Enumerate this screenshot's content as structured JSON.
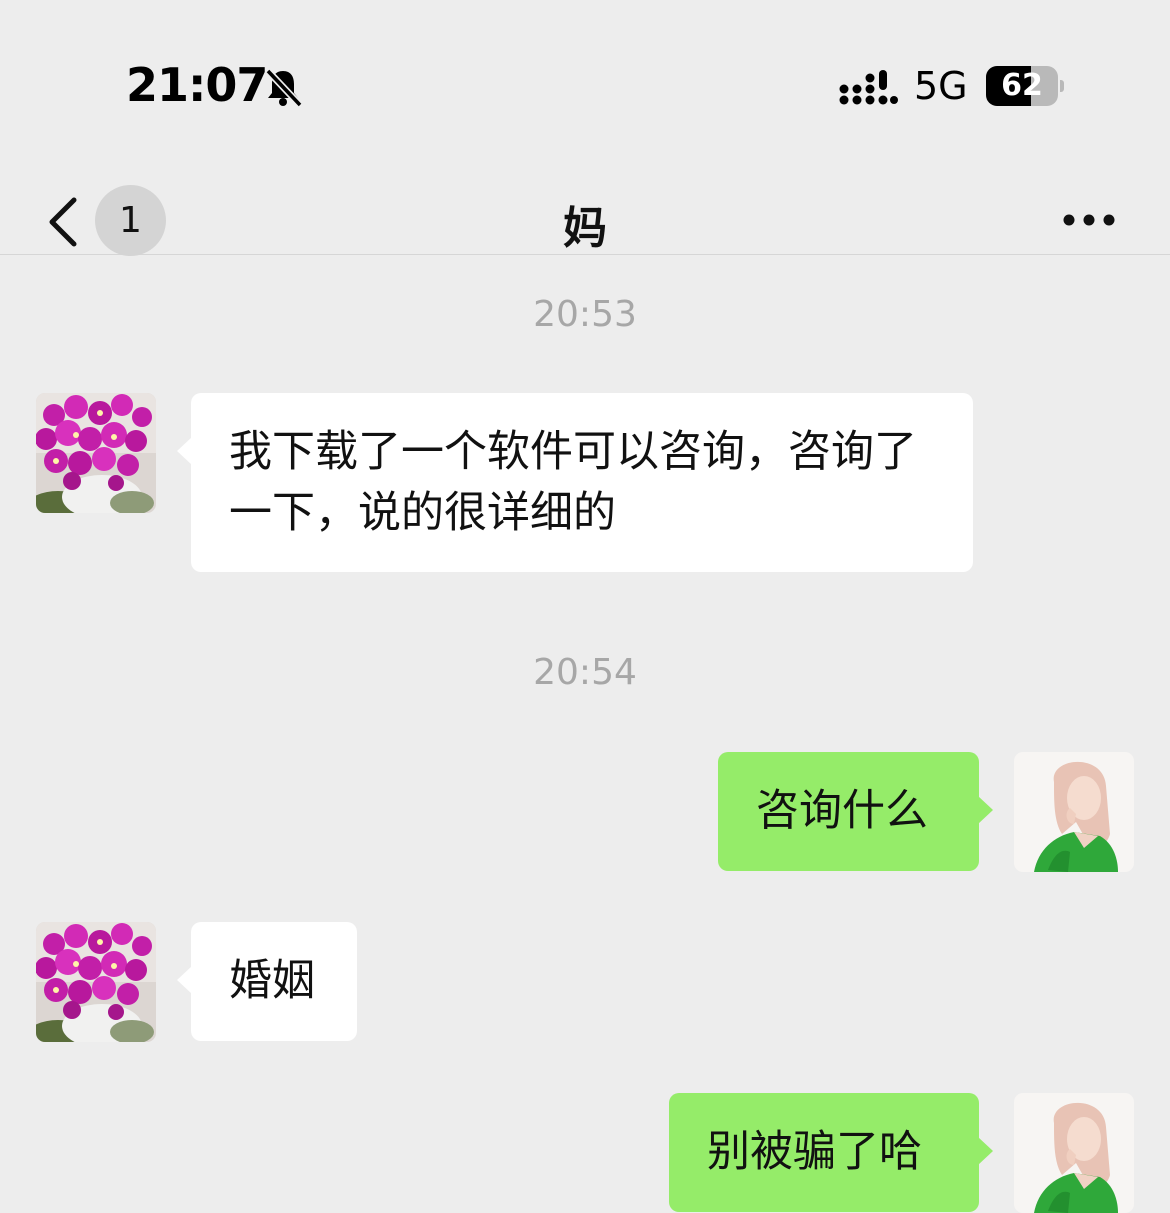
{
  "status_bar": {
    "time": "21:07",
    "mute_icon": "bell-slash-icon",
    "signal_icon": "cellular-signal-icon",
    "network": "5G",
    "battery_level": "62",
    "battery_fraction": 0.62
  },
  "nav": {
    "back_icon": "chevron-left-icon",
    "unread_count": "1",
    "title": "妈",
    "more_icon": "ellipsis-icon"
  },
  "messages": [
    {
      "type": "timestamp",
      "text": "20:53"
    },
    {
      "type": "incoming",
      "avatar": "orchid-avatar",
      "text": "我下载了一个软件可以咨询，咨询了一下，说的很详细的"
    },
    {
      "type": "timestamp",
      "text": "20:54"
    },
    {
      "type": "outgoing",
      "avatar": "user-avatar",
      "text": "咨询什么"
    },
    {
      "type": "incoming",
      "avatar": "orchid-avatar",
      "text": "婚姻"
    },
    {
      "type": "outgoing",
      "avatar": "user-avatar",
      "text": "别被骗了哈"
    }
  ],
  "colors": {
    "background": "#ededed",
    "incoming_bubble": "#ffffff",
    "outgoing_bubble": "#95ec69",
    "timestamp": "#a7a7a7",
    "orchid_flower": "#c21fa8"
  }
}
